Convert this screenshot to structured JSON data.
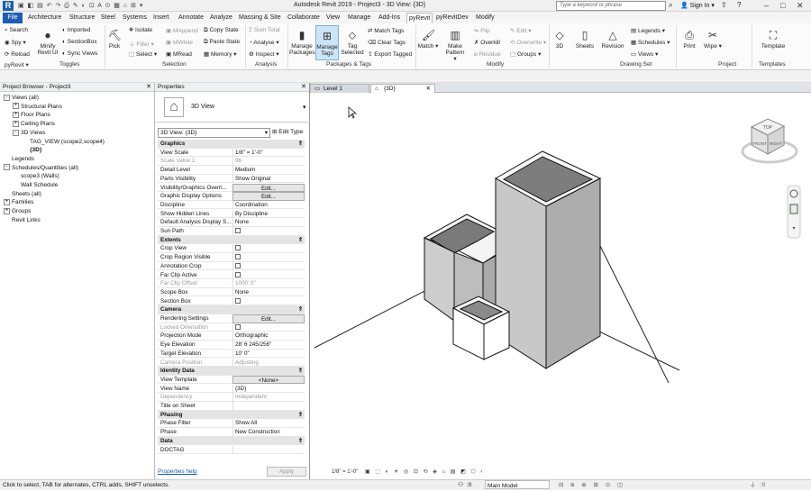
{
  "titlebar": {
    "logo": "R",
    "title": "Autodesk Revit 2019 - Project3 - 3D View: {3D}",
    "search_placeholder": "Type a keyword or phrase",
    "sign_in": "Sign In"
  },
  "ribbon_tabs": [
    "File",
    "Architecture",
    "Structure",
    "Steel",
    "Systems",
    "Insert",
    "Annotate",
    "Analyze",
    "Massing & Site",
    "Collaborate",
    "View",
    "Manage",
    "Add-Ins",
    "pyRevit",
    "pyRevitDev",
    "Modify"
  ],
  "active_tab": "pyRevit",
  "ribbon": {
    "pyrevit": {
      "search": "Search",
      "spy": "Spy",
      "reload": "Reload",
      "minify": "Minify Revit UI",
      "imported": "Imported",
      "sectionbox": "SectionBox",
      "sync_views": "Sync Views",
      "group": "pyRevit",
      "toggles": "Toggles"
    },
    "selection": {
      "pick": "Pick",
      "isolate": "Isolate",
      "filter": "Filter",
      "select": "Select",
      "mappend": "MAppend",
      "mwhite": "MWhite",
      "mread": "MRead",
      "copy_state": "Copy State",
      "paste_state": "Paste State",
      "memory": "Memory",
      "group": "Selection"
    },
    "analysis": {
      "sum_total": "Sum Total",
      "analyse": "Analyse",
      "inspect": "Inspect",
      "group": "Analysis"
    },
    "packages": {
      "manage_packages": "Manage Packages",
      "manage_tags": "Manage Tags",
      "tag_selected": "Tag Selected",
      "match_tags": "Match Tags",
      "clear_tags": "Clear Tags",
      "export_tagged": "Export Tagged",
      "group": "Packages & Tags"
    },
    "modify": {
      "match": "Match",
      "make_pattern": "Make Pattern",
      "flip": "Flip",
      "overkill": "Overkill",
      "residue": "Residue",
      "edit": "Edit",
      "overwrite": "Overwrite",
      "groups": "Groups",
      "group": "Modify"
    },
    "drawing_set": {
      "threed": "3D",
      "sheets": "Sheets",
      "revision": "Revision",
      "legends": "Legends",
      "schedules": "Schedules",
      "views": "Views",
      "group": "Drawing Set"
    },
    "project": {
      "print": "Print",
      "wipe": "Wipe",
      "group": "Project"
    },
    "templates": {
      "template": "Template",
      "group": "Templates"
    }
  },
  "project_browser": {
    "title": "Project Browser - Project3",
    "items": [
      {
        "label": "Views (all)",
        "level": 0,
        "exp": "-"
      },
      {
        "label": "Structural Plans",
        "level": 1,
        "exp": "+"
      },
      {
        "label": "Floor Plans",
        "level": 1,
        "exp": "+"
      },
      {
        "label": "Ceiling Plans",
        "level": 1,
        "exp": "+"
      },
      {
        "label": "3D Views",
        "level": 1,
        "exp": "-"
      },
      {
        "label": "TAG_VIEW (scope2,scope4)",
        "level": 2,
        "exp": ""
      },
      {
        "label": "{3D}",
        "level": 2,
        "exp": ""
      },
      {
        "label": "Legends",
        "level": 0,
        "exp": ""
      },
      {
        "label": "Schedules/Quantities (all)",
        "level": 0,
        "exp": "-"
      },
      {
        "label": "scope3 (Walls)",
        "level": 1,
        "exp": ""
      },
      {
        "label": "Wall Schedule",
        "level": 1,
        "exp": ""
      },
      {
        "label": "Sheets (all)",
        "level": 0,
        "exp": ""
      },
      {
        "label": "Families",
        "level": 0,
        "exp": "+"
      },
      {
        "label": "Groups",
        "level": 0,
        "exp": "+"
      },
      {
        "label": "Revit Links",
        "level": 0,
        "exp": ""
      }
    ]
  },
  "properties": {
    "title": "Properties",
    "type_name": "3D View",
    "selector": "3D View: {3D}",
    "edit_type": "Edit Type",
    "rows": [
      {
        "k": "Graphics",
        "sec": true
      },
      {
        "k": "View Scale",
        "v": "1/8\" = 1'-0\""
      },
      {
        "k": "Scale Value    1:",
        "v": "96",
        "dim": true
      },
      {
        "k": "Detail Level",
        "v": "Medium"
      },
      {
        "k": "Parts Visibility",
        "v": "Show Original"
      },
      {
        "k": "Visibility/Graphics Overri...",
        "v": "Edit...",
        "btn": true
      },
      {
        "k": "Graphic Display Options",
        "v": "Edit...",
        "btn": true
      },
      {
        "k": "Discipline",
        "v": "Coordination"
      },
      {
        "k": "Show Hidden Lines",
        "v": "By Discipline"
      },
      {
        "k": "Default Analysis Display S...",
        "v": "None"
      },
      {
        "k": "Sun Path",
        "chk": true
      },
      {
        "k": "Extents",
        "sec": true
      },
      {
        "k": "Crop View",
        "chk": true
      },
      {
        "k": "Crop Region Visible",
        "chk": true
      },
      {
        "k": "Annotation Crop",
        "chk": true
      },
      {
        "k": "Far Clip Active",
        "chk": true
      },
      {
        "k": "Far Clip Offset",
        "v": "1000'  0\"",
        "dim": true
      },
      {
        "k": "Scope Box",
        "v": "None"
      },
      {
        "k": "Section Box",
        "chk": true
      },
      {
        "k": "Camera",
        "sec": true
      },
      {
        "k": "Rendering Settings",
        "v": "Edit...",
        "btn": true
      },
      {
        "k": "Locked Orientation",
        "chk": true,
        "dim": true
      },
      {
        "k": "Projection Mode",
        "v": "Orthographic"
      },
      {
        "k": "Eye Elevation",
        "v": "28'  6 245/256\""
      },
      {
        "k": "Target Elevation",
        "v": "10'  0\""
      },
      {
        "k": "Camera Position",
        "v": "Adjusting",
        "dim": true
      },
      {
        "k": "Identity Data",
        "sec": true
      },
      {
        "k": "View Template",
        "v": "<None>",
        "btn": true
      },
      {
        "k": "View Name",
        "v": "{3D}"
      },
      {
        "k": "Dependency",
        "v": "Independent",
        "dim": true
      },
      {
        "k": "Title on Sheet",
        "v": ""
      },
      {
        "k": "Phasing",
        "sec": true
      },
      {
        "k": "Phase Filter",
        "v": "Show All"
      },
      {
        "k": "Phase",
        "v": "New Construction"
      },
      {
        "k": "Data",
        "sec": true
      },
      {
        "k": "DOCTAG",
        "v": ""
      }
    ],
    "help_link": "Properties help",
    "apply": "Apply"
  },
  "view_tabs": [
    {
      "label": "Level 1",
      "active": false
    },
    {
      "label": "{3D}",
      "active": true
    }
  ],
  "view_control_bar": {
    "scale": "1/8\" = 1'-0\""
  },
  "status": {
    "message": "Click to select, TAB for alternates, CTRL adds, SHIFT unselects.",
    "model": "Main Model",
    "zero": ":0"
  },
  "viewcube": {
    "face": "FRONT",
    "side": "RIGHT",
    "top": "TOP"
  }
}
